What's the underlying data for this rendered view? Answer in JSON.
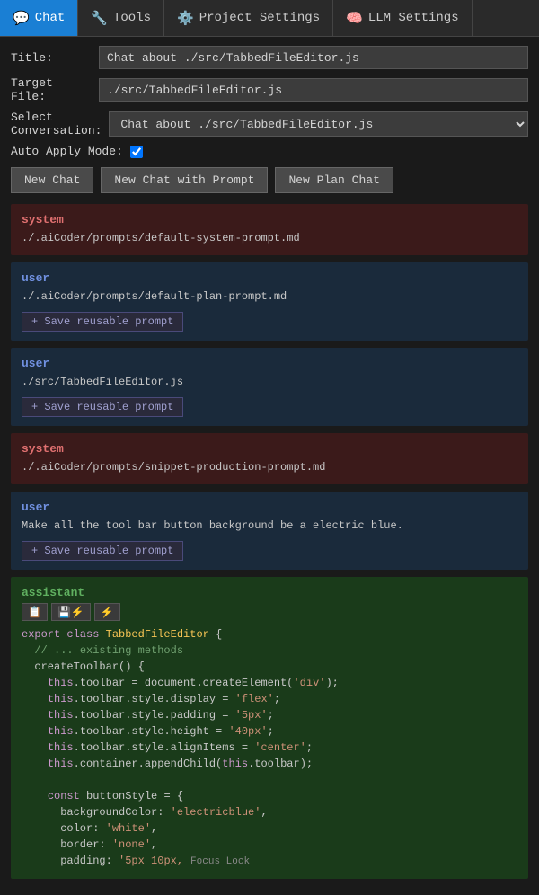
{
  "tabs": [
    {
      "id": "chat",
      "label": "Chat",
      "icon": "💬",
      "active": true
    },
    {
      "id": "tools",
      "label": "Tools",
      "icon": "🔧",
      "active": false
    },
    {
      "id": "project-settings",
      "label": "Project Settings",
      "icon": "⚙️",
      "active": false
    },
    {
      "id": "llm-settings",
      "label": "LLM Settings",
      "icon": "🧠",
      "active": false
    }
  ],
  "form": {
    "title_label": "Title:",
    "title_value": "Chat about ./src/TabbedFileEditor.js",
    "target_file_label": "Target\nFile:",
    "target_file_value": "./src/TabbedFileEditor.js",
    "select_conversation_label": "Select\nConversation:",
    "select_conversation_value": "Chat about ./src/TabbedFileEditor.js",
    "auto_apply_label": "Auto Apply Mode:",
    "auto_apply_checked": true
  },
  "buttons": {
    "new_chat": "New Chat",
    "new_chat_prompt": "New Chat with Prompt",
    "new_plan_chat": "New Plan Chat"
  },
  "messages": [
    {
      "role": "system",
      "content": "./.aiCoder/prompts/default-system-prompt.md",
      "has_save": false
    },
    {
      "role": "user",
      "content": "./.aiCoder/prompts/default-plan-prompt.md",
      "has_save": true,
      "save_label": "+ Save reusable prompt"
    },
    {
      "role": "user",
      "content": "./src/TabbedFileEditor.js",
      "has_save": true,
      "save_label": "+ Save reusable prompt"
    },
    {
      "role": "system",
      "content": "./.aiCoder/prompts/snippet-production-prompt.md",
      "has_save": false
    },
    {
      "role": "user",
      "content": "Make all the tool bar button background be a electric blue.",
      "has_save": true,
      "save_label": "+ Save reusable prompt"
    }
  ],
  "assistant": {
    "role": "assistant",
    "toolbar_buttons": [
      "📋",
      "💾⚡",
      ""
    ],
    "code": "export class TabbedFileEditor {\n  // ... existing methods\n  createToolbar() {\n    this.toolbar = document.createElement('div');\n    this.toolbar.style.display = 'flex';\n    this.toolbar.style.padding = '5px';\n    this.toolbar.style.height = '40px';\n    this.toolbar.style.alignItems = 'center';\n    this.container.appendChild(this.toolbar);\n\n    const buttonStyle = {\n      backgroundColor: 'electricblue',\n      color: 'white',\n      border: 'none',\n      padding: '5px 10px,",
    "focus_lock_label": "Focus Lock"
  }
}
